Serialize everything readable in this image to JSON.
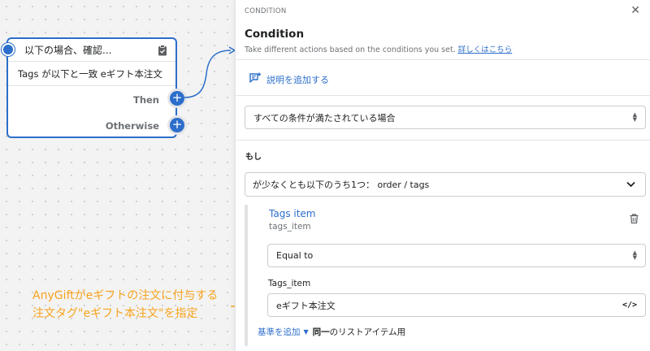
{
  "node": {
    "title": "以下の場合、確認...",
    "condition": "Tags が以下と一致 eギフト本注文",
    "then_label": "Then",
    "otherwise_label": "Otherwise"
  },
  "panel": {
    "caption": "CONDITION",
    "close": "✕",
    "title": "Condition",
    "subtitle": "Take different actions based on the conditions you set.",
    "learn_more": "詳しくはこちら",
    "add_description": "説明を追加する",
    "match_select": "すべての条件が満たされている場合",
    "if_label": "もし",
    "condition_select": "が少なくとも以下のうち1つ： order / tags",
    "item_title": "Tags item",
    "item_sub": "tags_item",
    "operator_select": "Equal to",
    "value_label": "Tags_item",
    "value_input": "eギフト本注文",
    "code_toggle": "</>",
    "add_criteria": "基準を追加",
    "same_label": "同一",
    "list_item_suffix": "のリストアイテム用"
  },
  "annotation": {
    "line1": "AnyGiftがeギフトの注文に付与する",
    "line2": "注文タグ\"eギフト本注文\"を指定"
  },
  "colors": {
    "accent": "#2c6ecb",
    "annotation": "#f7a31c",
    "border": "#c9cccf"
  },
  "icons": {
    "clipboard": "clipboard-icon",
    "plus": "plus-icon",
    "note": "note-icon",
    "trash": "trash-icon",
    "close": "close-icon",
    "code": "code-icon"
  }
}
